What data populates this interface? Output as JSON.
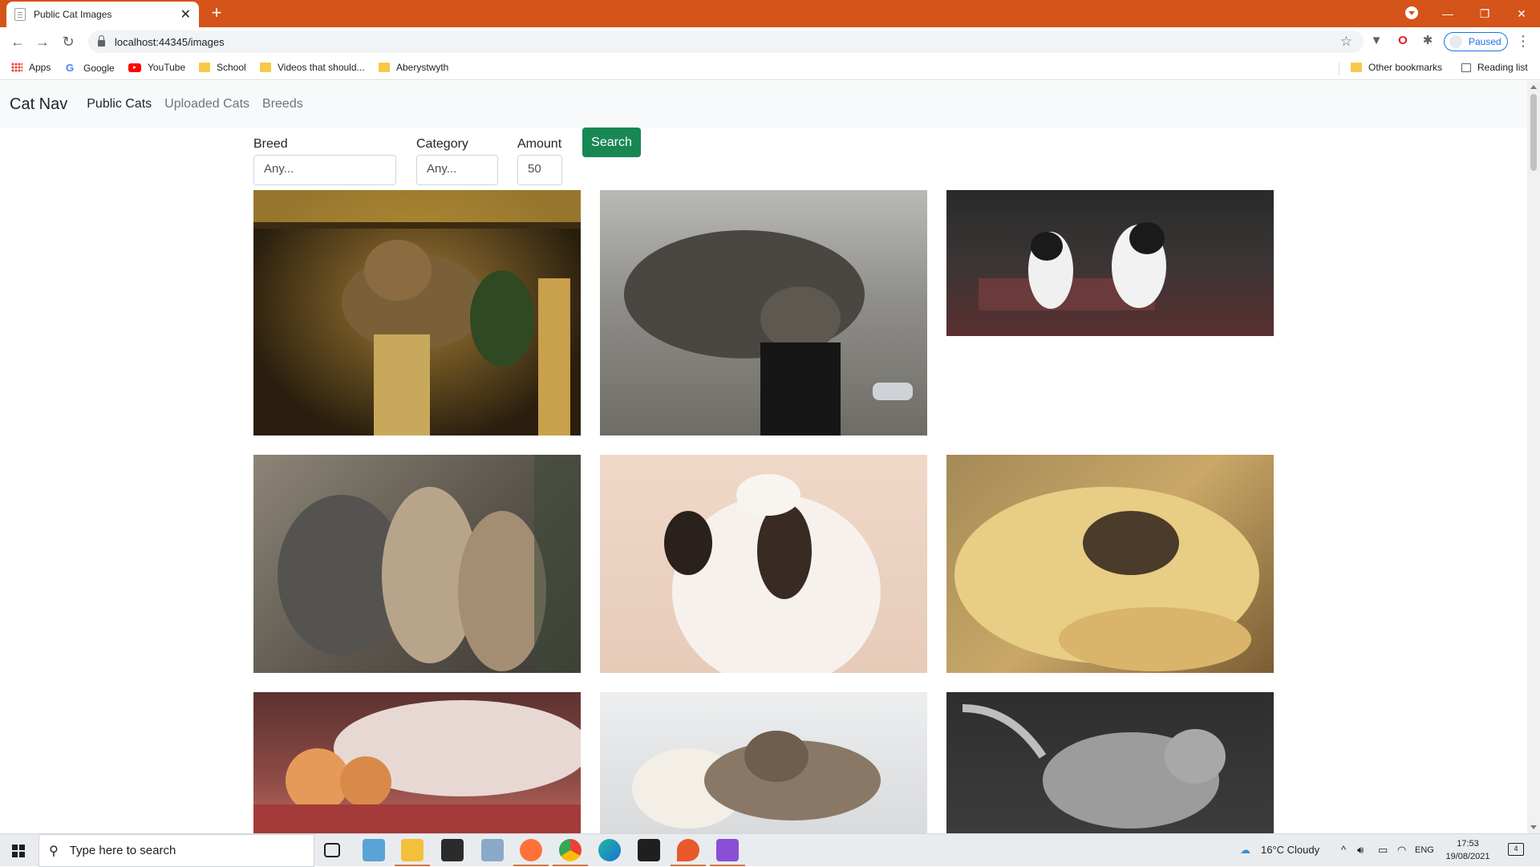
{
  "browser": {
    "tab_title": "Public Cat Images",
    "new_tab_symbol": "+",
    "url": "localhost:44345/images",
    "profile_status": "Paused",
    "window_controls": [
      "minimize-icon",
      "restore-icon",
      "close-icon"
    ]
  },
  "bookmarks": {
    "items": [
      {
        "label": "Apps",
        "icon": "apps-grid-icon"
      },
      {
        "label": "Google",
        "icon": "google-icon"
      },
      {
        "label": "YouTube",
        "icon": "youtube-icon"
      },
      {
        "label": "School",
        "icon": "folder-icon"
      },
      {
        "label": "Videos that should...",
        "icon": "folder-icon"
      },
      {
        "label": "Aberystwyth",
        "icon": "folder-icon"
      }
    ],
    "other": "Other bookmarks",
    "reading_list": "Reading list"
  },
  "navbar": {
    "brand": "Cat Nav",
    "links": [
      {
        "label": "Public Cats",
        "active": true
      },
      {
        "label": "Uploaded Cats",
        "active": false
      },
      {
        "label": "Breeds",
        "active": false
      }
    ]
  },
  "filters": {
    "breed": {
      "label": "Breed",
      "value": "Any..."
    },
    "category": {
      "label": "Category",
      "value": "Any..."
    },
    "amount": {
      "label": "Amount",
      "value": "50"
    },
    "search_label": "Search"
  },
  "gallery": {
    "images": [
      "tabby cat lying on scratching post",
      "tabby cat leaning on speaker",
      "two black and white kittens playing",
      "three cats looking out window",
      "black and white cat looking up",
      "kitten in laundry basket with towel",
      "ginger kittens on pink blanket",
      "kitten sleeping with plush sheep",
      "grey kitten walking"
    ]
  },
  "taskbar": {
    "search_placeholder": "Type here to search",
    "weather": "16°C  Cloudy",
    "language": "ENG",
    "time": "17:53",
    "date": "19/08/2021",
    "notifications": "4"
  },
  "colors": {
    "titlebar": "#d4541a",
    "search_button": "#198754",
    "navbar_bg": "#f8f9fa"
  }
}
